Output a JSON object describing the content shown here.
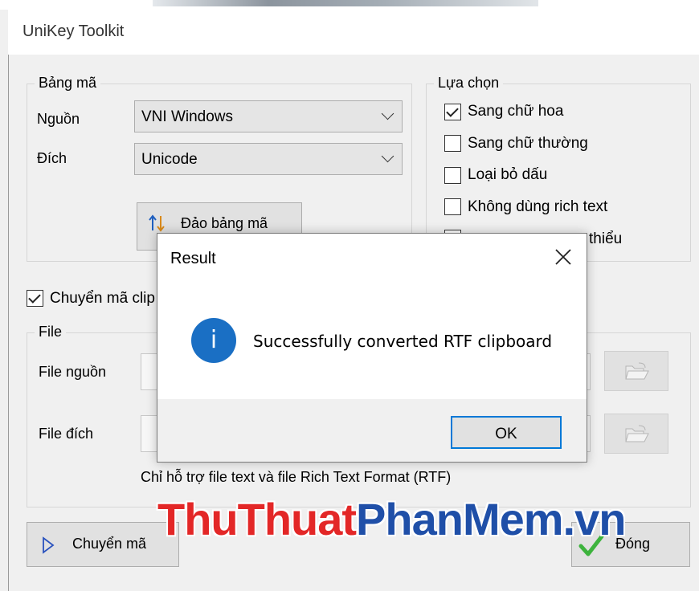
{
  "window": {
    "title": "UniKey Toolkit"
  },
  "bang_ma": {
    "group_label": "Bảng mã",
    "source_label": "Nguồn",
    "source_value": "VNI Windows",
    "target_label": "Đích",
    "target_value": "Unicode",
    "swap_button": "Đảo bảng mã"
  },
  "lua_chon": {
    "group_label": "Lựa chọn",
    "options": [
      {
        "label": "Sang chữ hoa",
        "checked": true
      },
      {
        "label": "Sang chữ thường",
        "checked": false
      },
      {
        "label": "Loại bỏ dấu",
        "checked": false
      },
      {
        "label": "Không dùng rich text",
        "checked": false
      },
      {
        "label": "thiểu",
        "checked": false
      }
    ]
  },
  "clipboard": {
    "label": "Chuyển mã clip",
    "checked": true
  },
  "file": {
    "group_label": "File",
    "source_label": "File nguồn",
    "target_label": "File đích",
    "note": "Chỉ hỗ trợ file text và file Rich Text Format (RTF)"
  },
  "actions": {
    "convert": "Chuyển mã",
    "close": "Đóng"
  },
  "dialog": {
    "title": "Result",
    "message": "Successfully converted RTF clipboard",
    "icon": "info-icon",
    "ok": "OK"
  },
  "watermark": {
    "part1": "ThuThuat",
    "part2": "PhanMem",
    "part3": ".vn"
  },
  "colors": {
    "accent": "#0078d7",
    "info": "#1a6fc4",
    "check": "#3db33d",
    "wm_red": "#e32727",
    "wm_blue": "#1f4fa8"
  }
}
